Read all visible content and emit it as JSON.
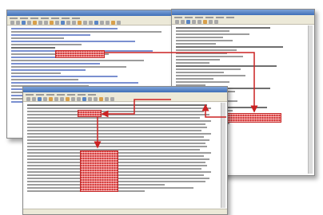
{
  "windows": [
    {
      "name": "source-window"
    },
    {
      "name": "detail-window"
    },
    {
      "name": "log-window"
    }
  ],
  "highlight_color": "#cc2222",
  "arrow_color": "#cc2222"
}
